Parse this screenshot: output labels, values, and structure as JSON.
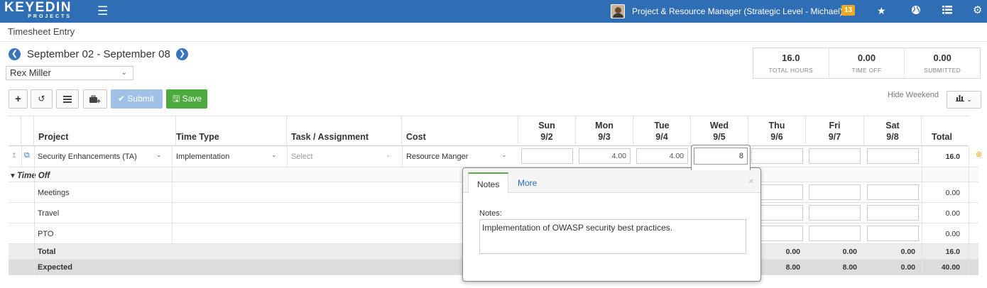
{
  "topbar": {
    "logo_name": "KEYEDIN",
    "logo_sub": "PROJECTS",
    "role": "Project & Resource Manager (Strategic Level - Michael)",
    "notification_count": "13",
    "icons": [
      "menu-icon",
      "star-icon",
      "globe-icon",
      "list-icon",
      "gear-icon"
    ]
  },
  "page": {
    "title": "Timesheet Entry",
    "date_range": "September 02 - September 08",
    "person": "Rex Miller"
  },
  "summary": [
    {
      "value": "16.0",
      "label": "TOTAL HOURS"
    },
    {
      "value": "0.00",
      "label": "TIME OFF"
    },
    {
      "value": "0.00",
      "label": "SUBMITTED"
    }
  ],
  "toolbar": {
    "submit_label": "Submit",
    "save_label": "Save",
    "hide_weekend": "Hide Weekend"
  },
  "grid": {
    "columns": {
      "project": "Project",
      "time_type": "Time Type",
      "task": "Task / Assignment",
      "cost": "Cost",
      "total": "Total"
    },
    "days": [
      {
        "name": "Sun",
        "date": "9/2"
      },
      {
        "name": "Mon",
        "date": "9/3"
      },
      {
        "name": "Tue",
        "date": "9/4"
      },
      {
        "name": "Wed",
        "date": "9/5"
      },
      {
        "name": "Thu",
        "date": "9/6"
      },
      {
        "name": "Fri",
        "date": "9/7"
      },
      {
        "name": "Sat",
        "date": "9/8"
      }
    ],
    "entry": {
      "project": "Security Enhancements (TA)",
      "time_type": "Implementation",
      "task_placeholder": "Select",
      "cost": "Resource Manger",
      "hours": [
        "",
        "4.00",
        "4.00",
        "8",
        "",
        "",
        ""
      ],
      "total": "16.0"
    },
    "time_off_label": "Time Off",
    "time_off_rows": [
      {
        "name": "Meetings",
        "total": "0.00"
      },
      {
        "name": "Travel",
        "total": "0.00"
      },
      {
        "name": "PTO",
        "total": "0.00"
      }
    ],
    "total_row": {
      "label": "Total",
      "thu": "0.00",
      "fri": "0.00",
      "sat": "0.00",
      "total": "16.0"
    },
    "expected_row": {
      "label": "Expected",
      "thu": "8.00",
      "fri": "8.00",
      "sat": "0.00",
      "total": "40.00"
    }
  },
  "popup": {
    "tab_notes": "Notes",
    "tab_more": "More",
    "notes_label": "Notes:",
    "notes_text": "Implementation of OWASP security best practices."
  },
  "colors": {
    "topbar": "#2f6db5",
    "save": "#4caa3e",
    "submit": "#9fc1e8",
    "badge": "#f0a820"
  }
}
